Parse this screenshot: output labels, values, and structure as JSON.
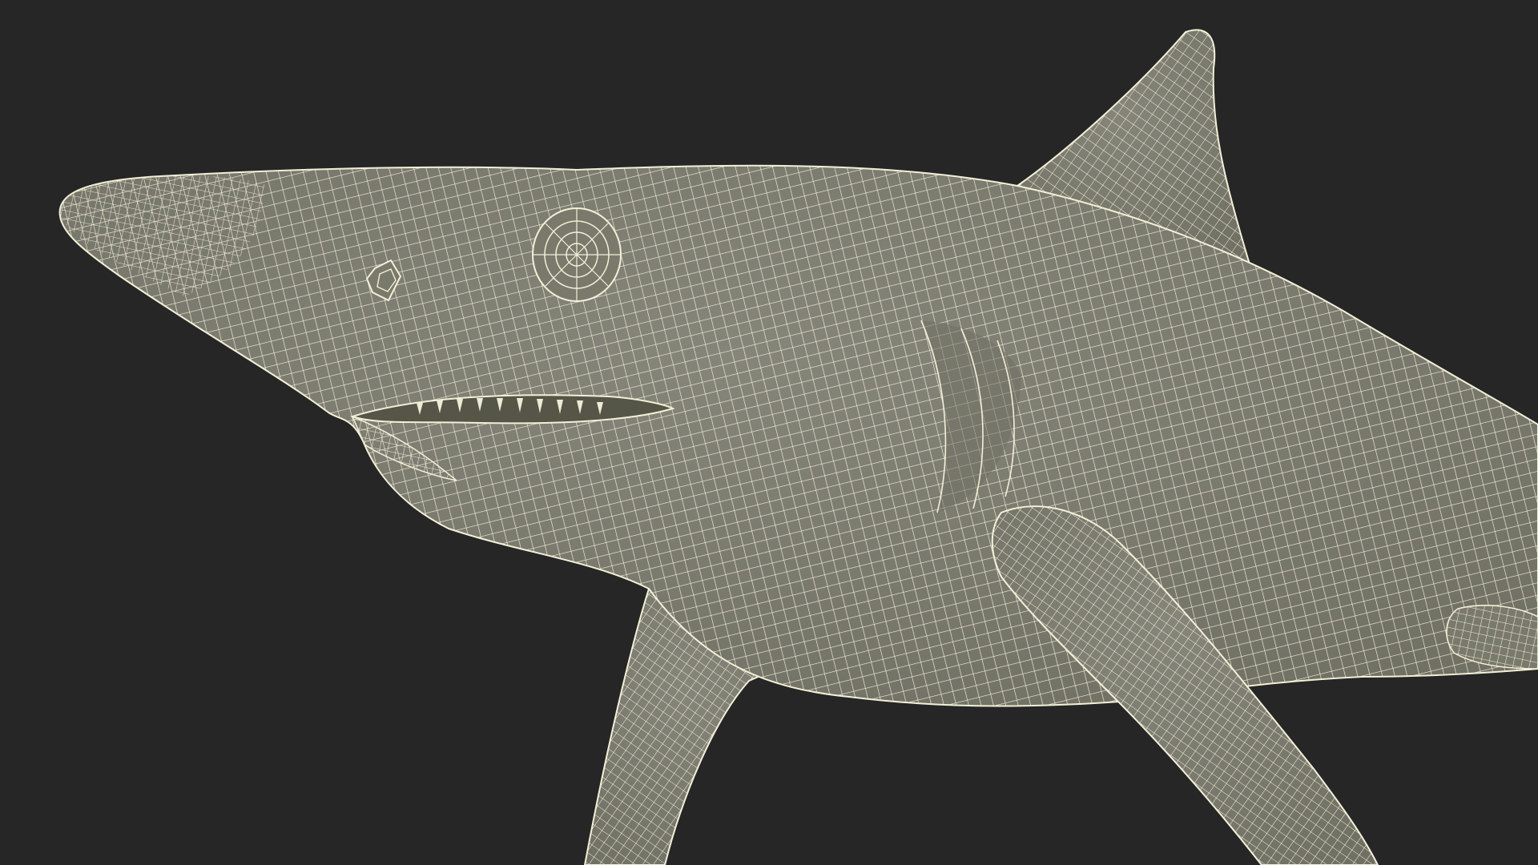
{
  "scene": {
    "subject": "shark-wireframe-render",
    "background_color": "#262626",
    "mesh_fill_color": "#7f7f70",
    "mesh_shadow_color": "#6e6e60",
    "wire_color": "#f2f0d8",
    "teeth_color": "#ecebd6"
  }
}
